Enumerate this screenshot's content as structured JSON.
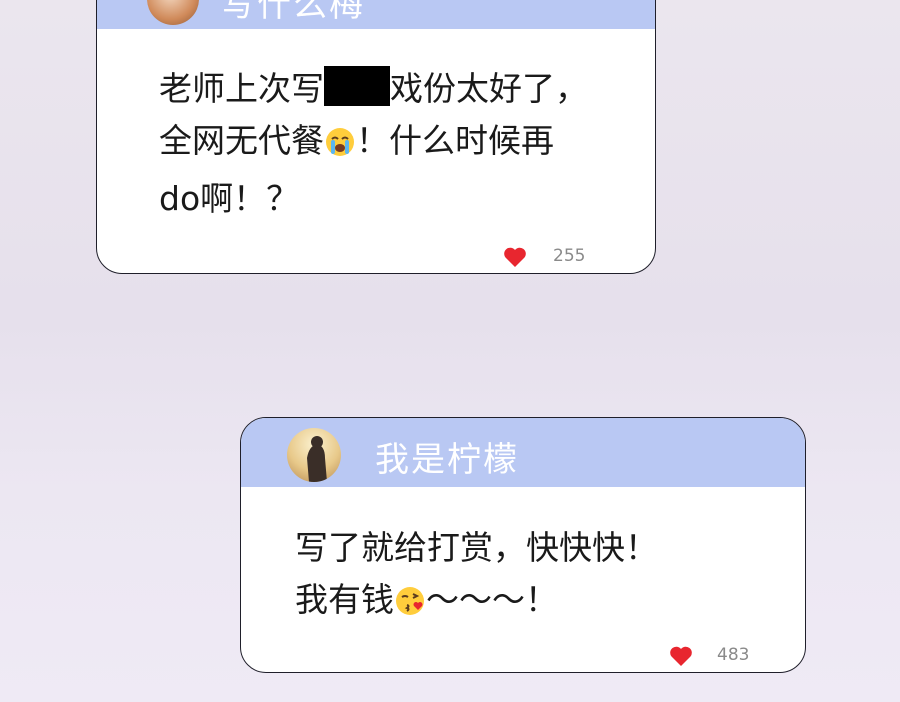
{
  "comments": [
    {
      "username": "写什么梅",
      "lines": [
        "老师上次写",
        "戏份太好了，",
        "全网无代餐",
        "！什么时候再",
        "do啊！？"
      ],
      "likes": "255"
    },
    {
      "username": "我是柠檬",
      "lines": [
        "写了就给打赏，快快快！",
        "我有钱",
        "〜〜〜！"
      ],
      "likes": "483"
    }
  ],
  "icons": {
    "like": "heart-icon",
    "crying_emoji": "loudly-crying-face-emoji",
    "kiss_emoji": "face-blowing-kiss-emoji"
  },
  "colors": {
    "header": "#b9c8f3",
    "heart": "#e8262f",
    "border": "#1f1f2a"
  }
}
